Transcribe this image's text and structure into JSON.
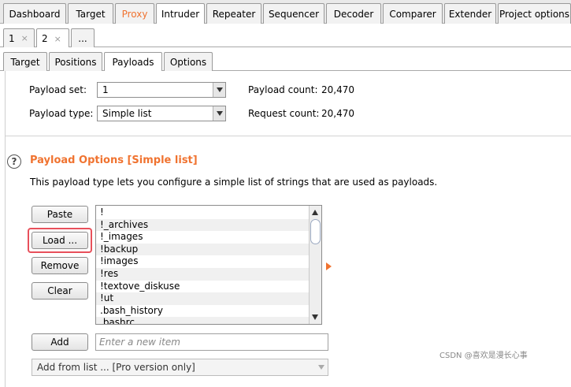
{
  "top_tabs": [
    "Dashboard",
    "Target",
    "Proxy",
    "Intruder",
    "Repeater",
    "Sequencer",
    "Decoder",
    "Comparer",
    "Extender",
    "Project options"
  ],
  "number_tabs": [
    {
      "label": "1",
      "close": "×"
    },
    {
      "label": "2",
      "close": "×"
    },
    {
      "label": "..."
    }
  ],
  "sub_tabs": [
    "Target",
    "Positions",
    "Payloads",
    "Options"
  ],
  "payload_set": {
    "label": "Payload set:",
    "value": "1",
    "count_label": "Payload count:",
    "count_value": "20,470"
  },
  "payload_type": {
    "label": "Payload type:",
    "value": "Simple list",
    "request_label": "Request count:",
    "request_value": "20,470"
  },
  "payload_options": {
    "help": "?",
    "title": "Payload Options [Simple list]",
    "description": "This payload type lets you configure a simple list of strings that are used as payloads.",
    "buttons": {
      "paste": "Paste",
      "load": "Load ...",
      "remove": "Remove",
      "clear": "Clear",
      "add": "Add"
    },
    "list_items": [
      "!",
      "!_archives",
      "!_images",
      "!backup",
      "!images",
      "!res",
      "!textove_diskuse",
      "!ut",
      ".bash_history",
      ".bashrc"
    ],
    "new_item_placeholder": "Enter a new item",
    "add_from_list": "Add from list ... [Pro version only]"
  },
  "watermark": "CSDN @喜欢是漫长心事",
  "colors": {
    "accent": "#f07330",
    "highlight": "#e8505b"
  }
}
